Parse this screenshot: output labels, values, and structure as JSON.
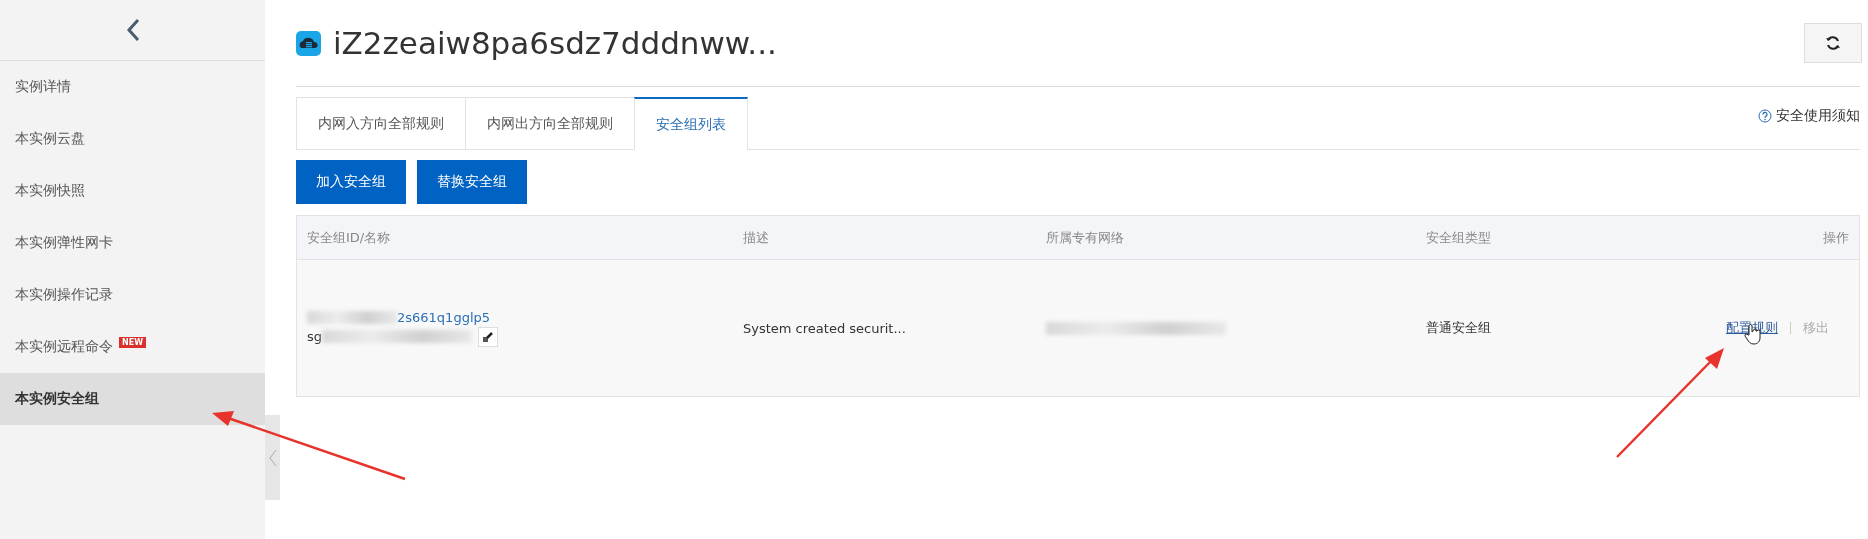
{
  "sidebar": {
    "items": [
      {
        "label": "实例详情",
        "selected": false
      },
      {
        "label": "本实例云盘",
        "selected": false
      },
      {
        "label": "本实例快照",
        "selected": false
      },
      {
        "label": "本实例弹性网卡",
        "selected": false
      },
      {
        "label": "本实例操作记录",
        "selected": false
      },
      {
        "label": "本实例远程命令",
        "selected": false,
        "badge": "NEW"
      },
      {
        "label": "本实例安全组",
        "selected": true
      }
    ]
  },
  "header": {
    "title": "iZ2zeaiw8pa6sdz7dddnww..."
  },
  "tabs": [
    {
      "label": "内网入方向全部规则",
      "selected": false
    },
    {
      "label": "内网出方向全部规则",
      "selected": false
    },
    {
      "label": "安全组列表",
      "selected": true
    }
  ],
  "help_link": "安全使用须知",
  "buttons": [
    "加入安全组",
    "替换安全组"
  ],
  "table": {
    "columns": [
      "安全组ID/名称",
      "描述",
      "所属专有网络",
      "安全组类型",
      "操作"
    ],
    "rows": [
      {
        "id": "2s661q1gglp5",
        "name": "sg",
        "description": "System created securit...",
        "type": "普通安全组",
        "actions": [
          {
            "label": "配置规则",
            "disabled": false
          },
          {
            "label": "移出",
            "disabled": true
          }
        ]
      }
    ]
  }
}
